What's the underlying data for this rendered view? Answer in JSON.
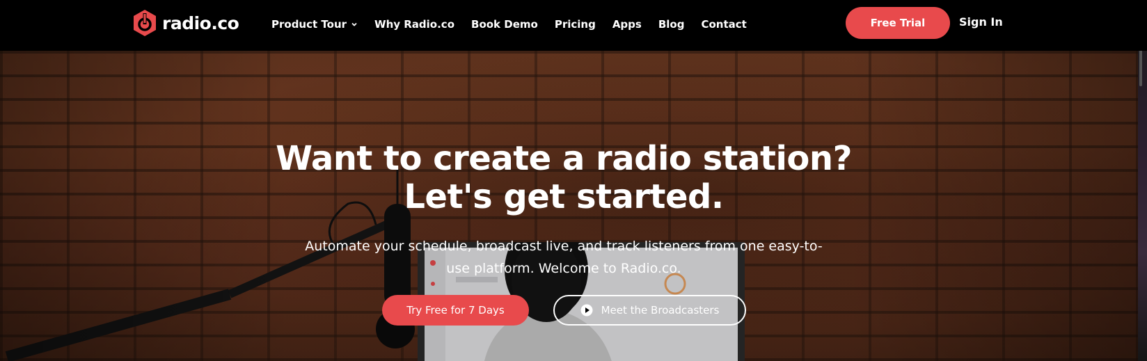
{
  "brand": {
    "name": "radio.co",
    "color": "#e84a4c"
  },
  "nav": {
    "items": [
      {
        "label": "Product Tour",
        "has_dropdown": true
      },
      {
        "label": "Why Radio.co"
      },
      {
        "label": "Book Demo"
      },
      {
        "label": "Pricing"
      },
      {
        "label": "Apps"
      },
      {
        "label": "Blog"
      },
      {
        "label": "Contact"
      }
    ],
    "cta_label": "Free Trial",
    "sign_in_label": "Sign In"
  },
  "hero": {
    "title_line1": "Want to create a radio station?",
    "title_line2": "Let's get started.",
    "subtitle": "Automate your schedule, broadcast live, and track listeners from one easy-to-use platform. Welcome to Radio.co.",
    "primary_button": "Try Free for 7 Days",
    "secondary_button": "Meet the Broadcasters",
    "secondary_icon": "play-circle-icon"
  }
}
